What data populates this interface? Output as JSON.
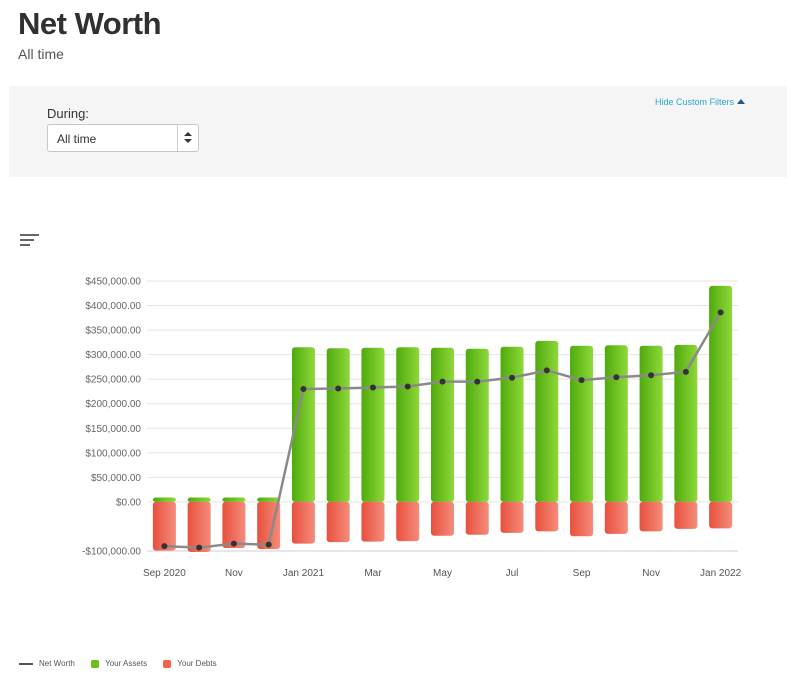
{
  "header": {
    "title": "Net Worth",
    "subtitle": "All time"
  },
  "filters": {
    "during_label": "During:",
    "during_value": "All time",
    "hide_link": "Hide Custom Filters"
  },
  "icons": {
    "chart_menu": "hamburger-menu-icon",
    "select_arrows": "select-updown-icon",
    "hide_filters": "caret-up-icon"
  },
  "colors": {
    "assets": "#6cc118",
    "debts": "#f0634f",
    "net_worth": "#8a8a8a",
    "link": "#2aa8cc"
  },
  "chart_data": {
    "type": "bar",
    "x": [
      "2020-09",
      "2020-10",
      "2020-11",
      "2020-12",
      "2021-01",
      "2021-02",
      "2021-03",
      "2021-04",
      "2021-05",
      "2021-06",
      "2021-07",
      "2021-08",
      "2021-09",
      "2021-10",
      "2021-11",
      "2021-12",
      "2022-01"
    ],
    "x_tick_labels": [
      "Sep 2020",
      "",
      "Nov",
      "",
      "Jan 2021",
      "",
      "Mar",
      "",
      "May",
      "",
      "Jul",
      "",
      "Sep",
      "",
      "Nov",
      "",
      "Jan 2022"
    ],
    "y_tick_labels": [
      "$450,000.00",
      "$400,000.00",
      "$350,000.00",
      "$300,000.00",
      "$250,000.00",
      "$200,000.00",
      "$150,000.00",
      "$100,000.00",
      "$50,000.00",
      "$0.00",
      "-$100,000.00"
    ],
    "y_ticks": [
      450000,
      400000,
      350000,
      300000,
      250000,
      200000,
      150000,
      100000,
      50000,
      0,
      -100000
    ],
    "ylim": [
      -100000,
      450000
    ],
    "grid": true,
    "legend_position": "bottom-left",
    "series": [
      {
        "name": "Net Worth",
        "type": "line",
        "values": [
          -90000,
          -93000,
          -85000,
          -87000,
          230000,
          231000,
          233000,
          235000,
          245000,
          245000,
          253000,
          268000,
          248000,
          254000,
          258000,
          265000,
          386000
        ]
      },
      {
        "name": "Your Assets",
        "type": "bar",
        "values": [
          9000,
          9000,
          9000,
          9000,
          315000,
          313000,
          314000,
          315000,
          314000,
          312000,
          316000,
          328000,
          318000,
          319000,
          318000,
          320000,
          440000
        ]
      },
      {
        "name": "Your Debts",
        "type": "bar",
        "values": [
          -99000,
          -102000,
          -94000,
          -96000,
          -85000,
          -82000,
          -81000,
          -80000,
          -69000,
          -67000,
          -63000,
          -60000,
          -70000,
          -65000,
          -60000,
          -55000,
          -54000
        ]
      }
    ]
  }
}
